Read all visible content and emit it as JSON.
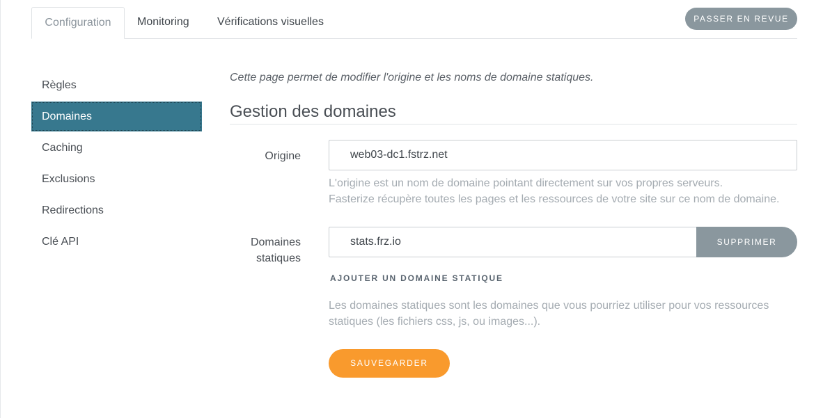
{
  "tabs": [
    {
      "label": "Configuration",
      "active": true
    },
    {
      "label": "Monitoring",
      "active": false
    },
    {
      "label": "Vérifications visuelles",
      "active": false
    }
  ],
  "review_button": "PASSER EN REVUE",
  "sidebar": {
    "items": [
      {
        "label": "Règles",
        "active": false
      },
      {
        "label": "Domaines",
        "active": true
      },
      {
        "label": "Caching",
        "active": false
      },
      {
        "label": "Exclusions",
        "active": false
      },
      {
        "label": "Redirections",
        "active": false
      },
      {
        "label": "Clé API",
        "active": false
      }
    ]
  },
  "main": {
    "intro": "Cette page permet de modifier l'origine et les noms de domaine statiques.",
    "section_title": "Gestion des domaines",
    "origin": {
      "label": "Origine",
      "value": "web03-dc1.fstrz.net",
      "help_line1": "L'origine est un nom de domaine pointant directement sur vos propres serveurs.",
      "help_line2": "Fasterize récupère toutes les pages et les ressources de votre site sur ce nom de domaine."
    },
    "static_domains": {
      "label_line1": "Domaines",
      "label_line2": "statiques",
      "values": [
        "stats.frz.io"
      ],
      "delete_label": "SUPPRIMER",
      "add_label": "AJOUTER UN DOMAINE STATIQUE",
      "help_line1": "Les domaines statiques sont les domaines que vous pourriez utiliser pour vos ressources",
      "help_line2": "statiques (les fichiers css, js, ou images...)."
    },
    "save_label": "SAUVEGARDER"
  },
  "colors": {
    "active_sidebar": "#37788e",
    "secondary_button": "#8a979e",
    "save_button": "#f99a2d"
  }
}
